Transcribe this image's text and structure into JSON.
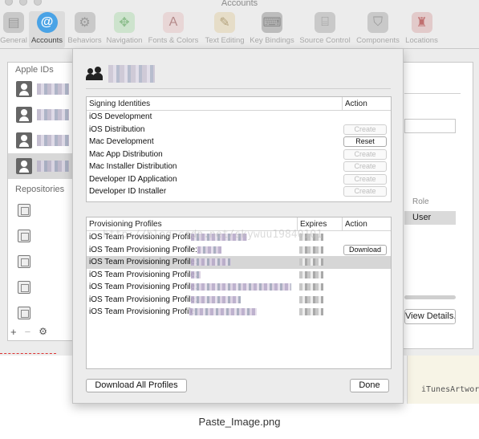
{
  "window": {
    "title": "Accounts"
  },
  "toolbar": {
    "items": [
      {
        "label": "General",
        "icon": "switch-icon"
      },
      {
        "label": "Accounts",
        "icon": "at-icon"
      },
      {
        "label": "Behaviors",
        "icon": "gear-icon"
      },
      {
        "label": "Navigation",
        "icon": "arrows-icon"
      },
      {
        "label": "Fonts & Colors",
        "icon": "palette-icon"
      },
      {
        "label": "Text Editing",
        "icon": "pencil-icon"
      },
      {
        "label": "Key Bindings",
        "icon": "keyboard-icon"
      },
      {
        "label": "Source Control",
        "icon": "source-control-icon"
      },
      {
        "label": "Components",
        "icon": "shield-icon"
      },
      {
        "label": "Locations",
        "icon": "joystick-icon"
      }
    ],
    "selected": "Accounts"
  },
  "sidebar": {
    "apple_ids_header": "Apple IDs",
    "repositories_header": "Repositories",
    "add_label": "+",
    "remove_label": "−",
    "settings_label": "⚙"
  },
  "right_panel": {
    "role_header": "Role",
    "role_value": "User",
    "details_button": "View Details..."
  },
  "editor": {
    "text": "iTunesArtwork"
  },
  "sheet": {
    "signing": {
      "col_name": "Signing Identities",
      "col_action": "Action",
      "rows": [
        {
          "name": "iOS Development",
          "action": ""
        },
        {
          "name": "iOS Distribution",
          "action": "Create"
        },
        {
          "name": "Mac Development",
          "action": "Reset"
        },
        {
          "name": "Mac App Distribution",
          "action": "Create"
        },
        {
          "name": "Mac Installer Distribution",
          "action": "Create"
        },
        {
          "name": "Developer ID Application",
          "action": "Create"
        },
        {
          "name": "Developer ID Installer",
          "action": "Create"
        }
      ]
    },
    "profiles": {
      "col_name": "Provisioning Profiles",
      "col_expires": "Expires",
      "col_action": "Action",
      "rows": [
        {
          "name": "iOS Team Provisioning Profile",
          "action": ""
        },
        {
          "name": "iOS Team Provisioning Profile:",
          "action": "Download"
        },
        {
          "name": "iOS Team Provisioning Profile:",
          "action": ""
        },
        {
          "name": "iOS Team Provisioning Profile:",
          "action": ""
        },
        {
          "name": "iOS Team Provisioning Profile:",
          "action": ""
        },
        {
          "name": "iOS Team Provisioning Profile:",
          "action": ""
        },
        {
          "name": "iOS Team Provisioning Profile",
          "action": ""
        }
      ],
      "watermark": "http://blog.csdn.net/skywuu19840101"
    },
    "download_all_button": "Download All Profiles",
    "done_button": "Done"
  },
  "caption": "Paste_Image.png"
}
